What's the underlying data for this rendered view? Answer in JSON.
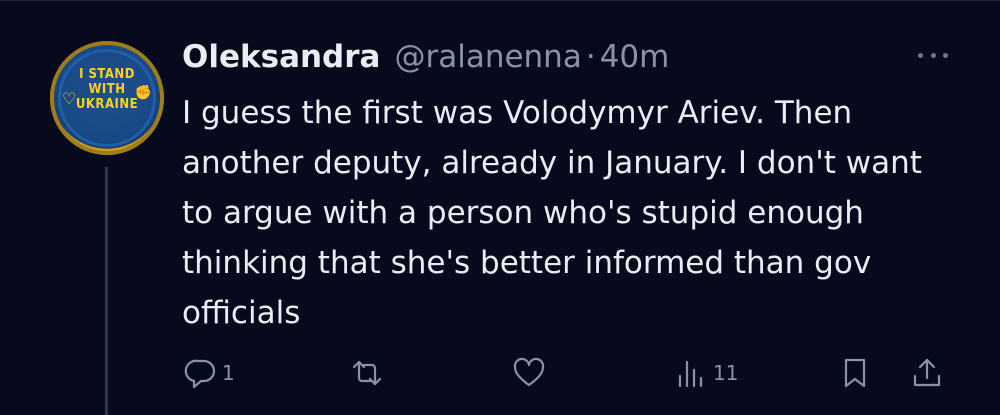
{
  "avatar": {
    "lines": [
      "I STAND",
      "WITH",
      "UKRAINE"
    ],
    "icons": [
      "heart-icon",
      "hand-icon"
    ]
  },
  "tweet": {
    "author_name": "Oleksandra",
    "handle": "@ralanenna",
    "separator": "·",
    "time": "40m",
    "text": "I guess the first was Volodymyr Ariev. Then another deputy, already in January. I don't want to argue with a person who's stupid enough thinking that she's better informed than gov officials"
  },
  "actions": {
    "reply_count": "1",
    "retweet_count": "",
    "like_count": "",
    "views_count": "11"
  },
  "icons": {
    "more": "more-horizontal-icon",
    "reply": "reply-icon",
    "retweet": "retweet-icon",
    "like": "heart-icon",
    "views": "views-chart-icon",
    "bookmark": "bookmark-icon",
    "share": "share-icon"
  },
  "colors": {
    "background": "#060a1c",
    "text_primary": "#e9ecf1",
    "text_secondary": "#8b93a3",
    "avatar_yellow": "#ffd21f",
    "avatar_blue": "#1a4a86"
  }
}
